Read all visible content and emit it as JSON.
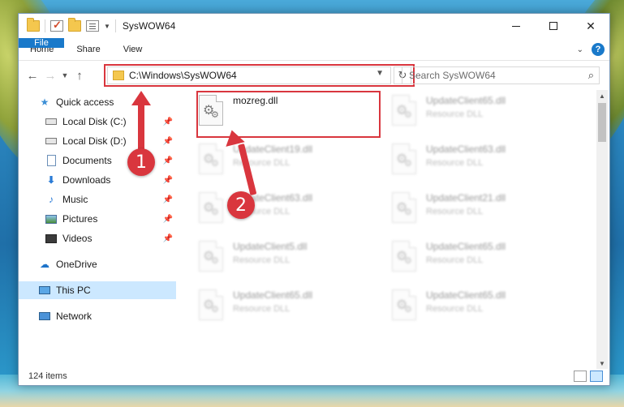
{
  "window": {
    "title": "SysWOW64"
  },
  "ribbon": {
    "tabs": [
      "File",
      "Home",
      "Share",
      "View"
    ]
  },
  "nav": {
    "address": "C:\\Windows\\SysWOW64",
    "search_placeholder": "Search SysWOW64"
  },
  "sidebar": {
    "items": [
      {
        "label": "Quick access",
        "icon": "star-icon"
      },
      {
        "label": "Local Disk (C:)",
        "icon": "drive-icon",
        "pinned": true
      },
      {
        "label": "Local Disk (D:)",
        "icon": "drive-icon",
        "pinned": true
      },
      {
        "label": "Documents",
        "icon": "documents-icon",
        "pinned": true
      },
      {
        "label": "Downloads",
        "icon": "download-icon",
        "pinned": true
      },
      {
        "label": "Music",
        "icon": "music-icon",
        "pinned": true
      },
      {
        "label": "Pictures",
        "icon": "pictures-icon",
        "pinned": true
      },
      {
        "label": "Videos",
        "icon": "videos-icon",
        "pinned": true
      },
      {
        "label": "OneDrive",
        "icon": "cloud-icon"
      },
      {
        "label": "This PC",
        "icon": "pc-icon",
        "selected": true
      },
      {
        "label": "Network",
        "icon": "network-icon"
      }
    ]
  },
  "files": {
    "highlighted": {
      "name": "mozreg.dll",
      "type": ""
    },
    "blurred": [
      {
        "name": "UpdateClient65.dll",
        "type": "Resource DLL"
      },
      {
        "name": "UpdateClient19.dll",
        "type": "Resource DLL"
      },
      {
        "name": "UpdateClient63.dll",
        "type": "Resource DLL"
      },
      {
        "name": "UpdateClient63.dll",
        "type": "Resource DLL"
      },
      {
        "name": "UpdateClient21.dll",
        "type": "Resource DLL"
      },
      {
        "name": "UpdateClient5.dll",
        "type": "Resource DLL"
      },
      {
        "name": "UpdateClient65.dll",
        "type": "Resource DLL"
      },
      {
        "name": "UpdateClient65.dll",
        "type": "Resource DLL"
      },
      {
        "name": "UpdateClient65.dll",
        "type": "Resource DLL"
      }
    ]
  },
  "status": {
    "item_count": "124 items"
  },
  "callouts": {
    "one": "1",
    "two": "2"
  },
  "colors": {
    "accent": "#1979ca",
    "highlight": "#d9363e",
    "selection": "#cce8ff"
  }
}
